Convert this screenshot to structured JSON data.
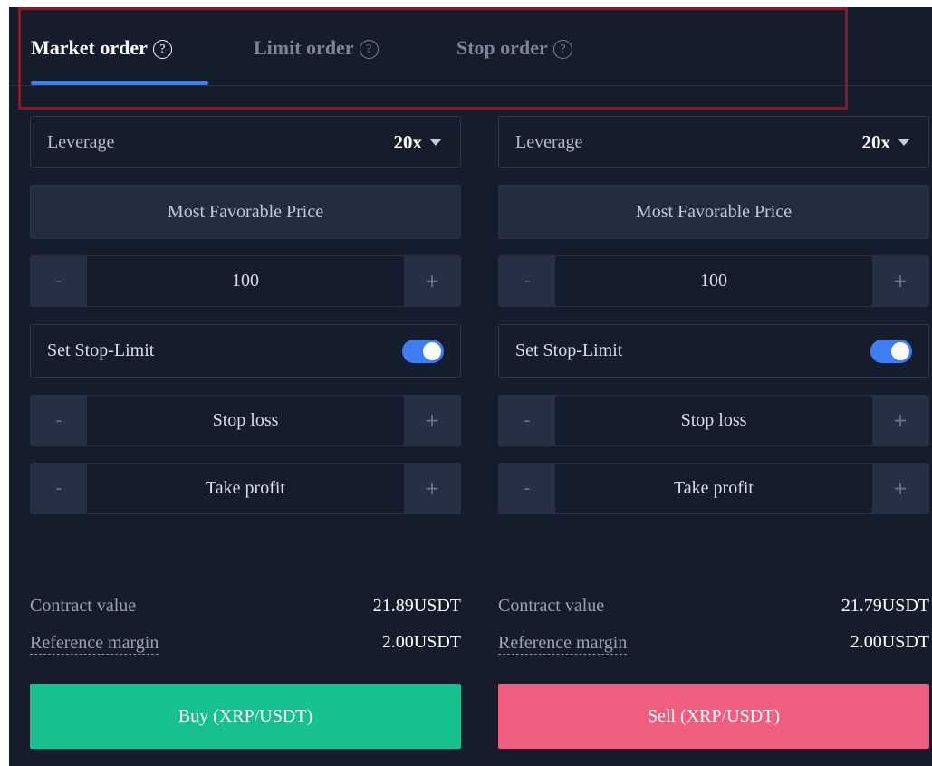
{
  "tabs": [
    {
      "label": "Market order",
      "help": "?"
    },
    {
      "label": "Limit order",
      "help": "?"
    },
    {
      "label": "Stop order",
      "help": "?"
    }
  ],
  "active_tab": "Market order",
  "buy_panel": {
    "leverage_label": "Leverage",
    "leverage_value": "20x",
    "price_label": "Most Favorable Price",
    "quantity": "100",
    "stop_limit_label": "Set Stop-Limit",
    "stop_limit_enabled": true,
    "stop_loss_placeholder": "Stop loss",
    "take_profit_placeholder": "Take profit",
    "minus": "-",
    "plus": "+",
    "contract_value_label": "Contract value",
    "contract_value": "21.89USDT",
    "reference_margin_label": "Reference margin",
    "reference_margin": "2.00USDT",
    "action_label": "Buy (XRP/USDT)"
  },
  "sell_panel": {
    "leverage_label": "Leverage",
    "leverage_value": "20x",
    "price_label": "Most Favorable Price",
    "quantity": "100",
    "stop_limit_label": "Set Stop-Limit",
    "stop_limit_enabled": true,
    "stop_loss_placeholder": "Stop loss",
    "take_profit_placeholder": "Take profit",
    "minus": "-",
    "plus": "+",
    "contract_value_label": "Contract value",
    "contract_value": "21.79USDT",
    "reference_margin_label": "Reference margin",
    "reference_margin": "2.00USDT",
    "action_label": "Sell (XRP/USDT)"
  },
  "colors": {
    "background": "#151c2c",
    "accent": "#3d7ff2",
    "buy": "#16c08f",
    "sell": "#ef5d7f",
    "highlight_box": "#7d1e2b"
  }
}
